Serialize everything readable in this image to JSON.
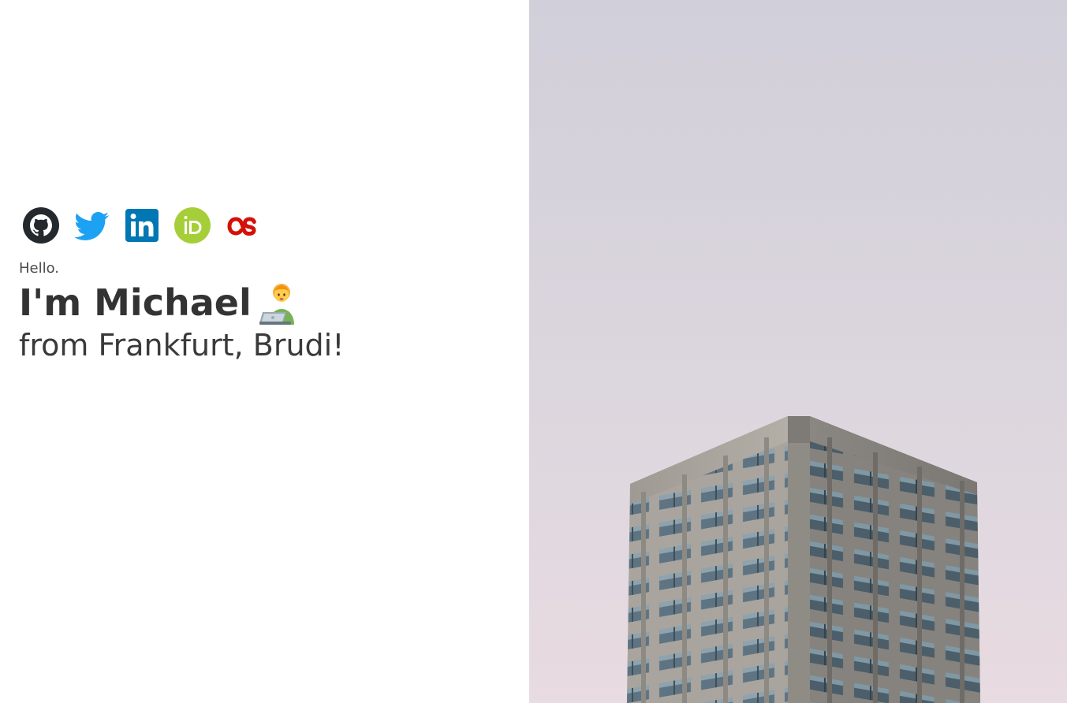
{
  "intro": {
    "greeting": "Hello.",
    "headline": "I'm Michael",
    "subheadline": "from Frankfurt, Brudi!"
  },
  "social_links": [
    {
      "name": "github",
      "icon": "github-icon",
      "color": "#24292e"
    },
    {
      "name": "twitter",
      "icon": "twitter-icon",
      "color": "#1da1f2"
    },
    {
      "name": "linkedin",
      "icon": "linkedin-icon",
      "color": "#0077b5"
    },
    {
      "name": "orcid",
      "icon": "orcid-icon",
      "color": "#a6ce39"
    },
    {
      "name": "lastfm",
      "icon": "lastfm-icon",
      "color": "#d51007"
    }
  ],
  "emoji": "technologist-emoji",
  "hero_image": {
    "subject": "building-photo",
    "sky_top": "#d1cfd9",
    "sky_bottom": "#e8dbe1"
  }
}
